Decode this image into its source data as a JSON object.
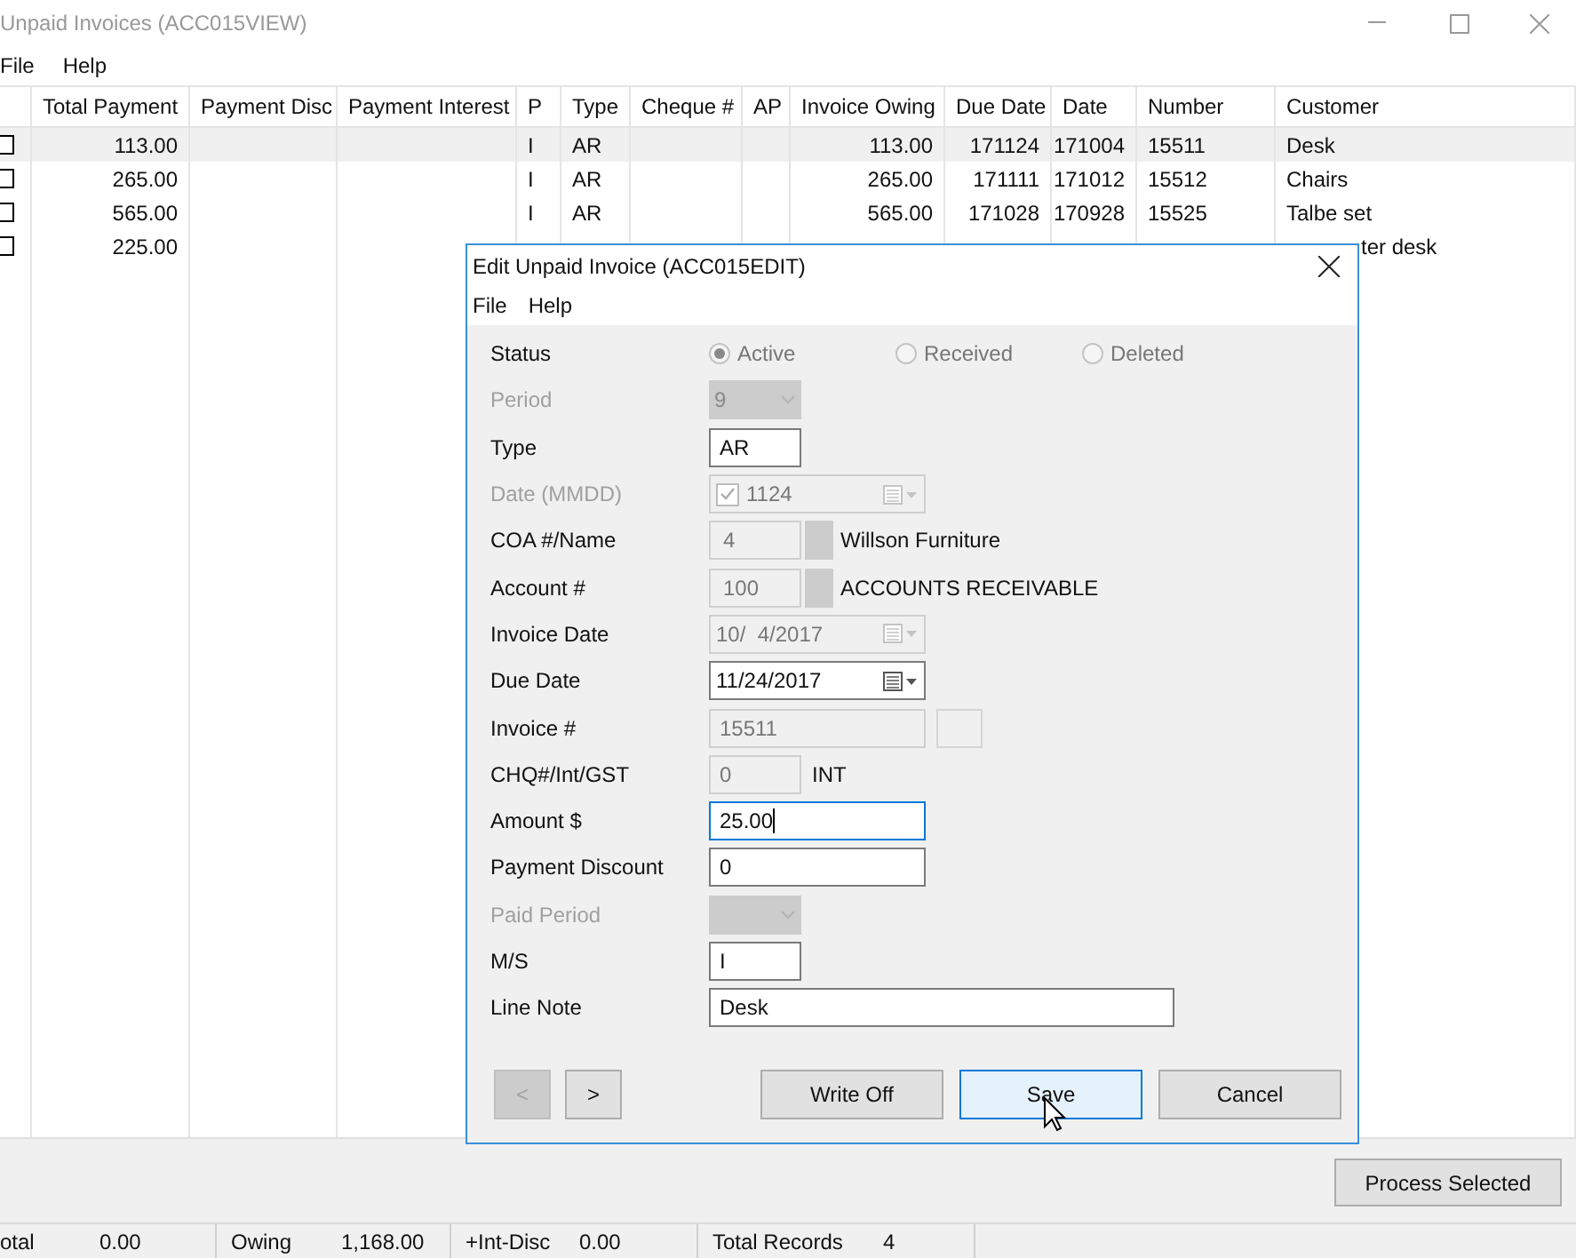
{
  "window": {
    "title": "Unpaid Invoices (ACC015VIEW)"
  },
  "menu": [
    "File",
    "Help"
  ],
  "columns": [
    "Total Payment",
    "Payment Disc",
    "Payment Interest",
    "P",
    "Type",
    "Cheque #",
    "AP",
    "Invoice Owing",
    "Due Date",
    "Date",
    "Number",
    "Customer"
  ],
  "rows": [
    {
      "checked": false,
      "selected": true,
      "total_payment": "113.00",
      "p": "I",
      "type": "AR",
      "invoice_owing": "113.00",
      "due_date": "171124",
      "date": "171004",
      "number": "15511",
      "customer": "Desk"
    },
    {
      "checked": false,
      "selected": false,
      "total_payment": "265.00",
      "p": "I",
      "type": "AR",
      "invoice_owing": "265.00",
      "due_date": "171111",
      "date": "171012",
      "number": "15512",
      "customer": "Chairs"
    },
    {
      "checked": false,
      "selected": false,
      "total_payment": "565.00",
      "p": "I",
      "type": "AR",
      "invoice_owing": "565.00",
      "due_date": "171028",
      "date": "170928",
      "number": "15525",
      "customer": "Talbe set"
    },
    {
      "checked": false,
      "selected": false,
      "covered": true,
      "total_payment": "225.00",
      "customer": "ter desk"
    }
  ],
  "process_button": "Process Selected",
  "status_bar": [
    {
      "label": "otal",
      "value": "0.00"
    },
    {
      "label": "Owing",
      "value": "1,168.00"
    },
    {
      "label": "+Int-Disc",
      "value": "0.00"
    },
    {
      "label": "Total Records",
      "value": "4"
    }
  ],
  "dialog": {
    "title": "Edit Unpaid Invoice (ACC015EDIT)",
    "menu": [
      "File",
      "Help"
    ],
    "fields": [
      {
        "kind": "radio",
        "label": "Status",
        "disabled": false,
        "read_only": true,
        "options": [
          {
            "label": "Active",
            "selected": true
          },
          {
            "label": "Received",
            "selected": false
          },
          {
            "label": "Deleted",
            "selected": false
          }
        ]
      },
      {
        "kind": "combo",
        "label": "Period",
        "disabled": true,
        "read_only": true,
        "value": "9"
      },
      {
        "kind": "short-text",
        "label": "Type",
        "disabled": false,
        "read_only": false,
        "value": "AR"
      },
      {
        "kind": "check-date",
        "label": "Date (MMDD)",
        "disabled": true,
        "read_only": true,
        "checked": true,
        "value": "1124"
      },
      {
        "kind": "lookup",
        "label": "COA #/Name",
        "disabled": false,
        "read_only": true,
        "value": "4",
        "name": "Willson Furniture"
      },
      {
        "kind": "lookup",
        "label": "Account #",
        "disabled": false,
        "read_only": true,
        "value": "100",
        "name": "ACCOUNTS RECEIVABLE"
      },
      {
        "kind": "date",
        "label": "Invoice Date",
        "disabled": false,
        "read_only": true,
        "value": "10/  4/2017"
      },
      {
        "kind": "date",
        "label": "Due Date",
        "disabled": false,
        "read_only": false,
        "value": "11/24/2017"
      },
      {
        "kind": "text-button",
        "label": "Invoice #",
        "disabled": false,
        "read_only": true,
        "value": "15511"
      },
      {
        "kind": "short-text",
        "label": "CHQ#/Int/GST",
        "disabled": false,
        "read_only": true,
        "value": "0",
        "suffix": "INT"
      },
      {
        "kind": "text",
        "label": "Amount $",
        "disabled": false,
        "read_only": false,
        "focused": true,
        "value": "25.00"
      },
      {
        "kind": "text",
        "label": "Payment Discount",
        "disabled": false,
        "read_only": false,
        "value": "0"
      },
      {
        "kind": "combo",
        "label": "Paid Period",
        "disabled": true,
        "read_only": true
      },
      {
        "kind": "short-text",
        "label": "M/S",
        "disabled": false,
        "read_only": false,
        "value": "I"
      },
      {
        "kind": "long-text",
        "label": "Line Note",
        "disabled": false,
        "read_only": false,
        "value": "Desk"
      }
    ],
    "nav": [
      {
        "label": "<",
        "disabled": true
      },
      {
        "label": ">",
        "disabled": false
      }
    ],
    "buttons": [
      {
        "label": "Write Off",
        "focused": false
      },
      {
        "label": "Save",
        "focused": true
      },
      {
        "label": "Cancel",
        "focused": false
      }
    ]
  }
}
